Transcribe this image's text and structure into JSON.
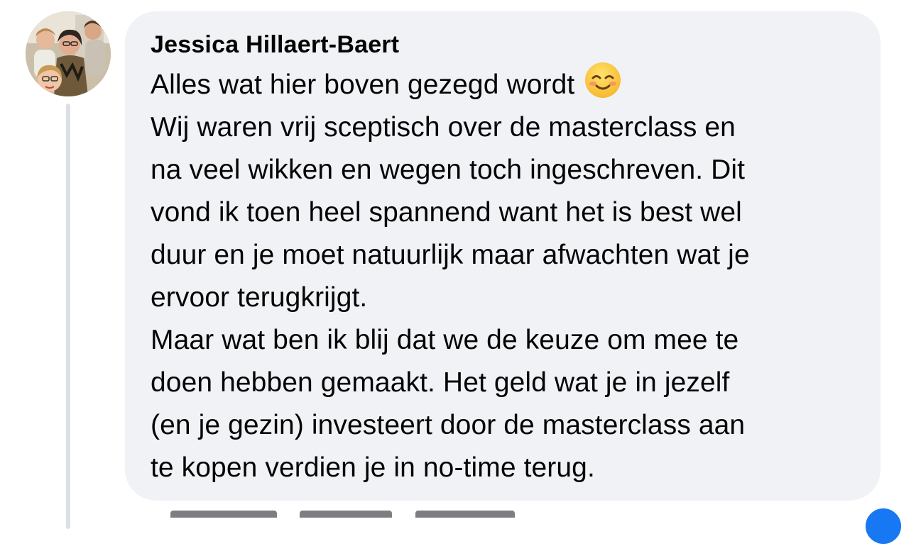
{
  "comment": {
    "author": "Jessica Hillaert-Baert",
    "avatar_icon": "profile-photo",
    "lines": [
      "Alles wat hier boven gezegd wordt",
      "Wij waren vrij sceptisch over de masterclass en",
      "na veel wikken en wegen toch ingeschreven. Dit",
      "vond ik toen heel spannend want het is best wel",
      "duur en je moet natuurlijk maar afwachten wat je",
      "ervoor terugkrijgt.",
      "Maar wat ben ik blij dat we de keuze om mee te",
      "doen hebben gemaakt. Het geld wat je in jezelf",
      "(en je gezin) investeert door de masterclass aan",
      "te kopen verdien je in no-time terug."
    ],
    "emoji_icon": "smiling-face-emoji",
    "reaction_icon": "like-icon",
    "colors": {
      "bubble": "#f0f2f5",
      "text": "#050505",
      "thread_line": "#dcdfe4",
      "like_badge": "#1877f2"
    }
  }
}
